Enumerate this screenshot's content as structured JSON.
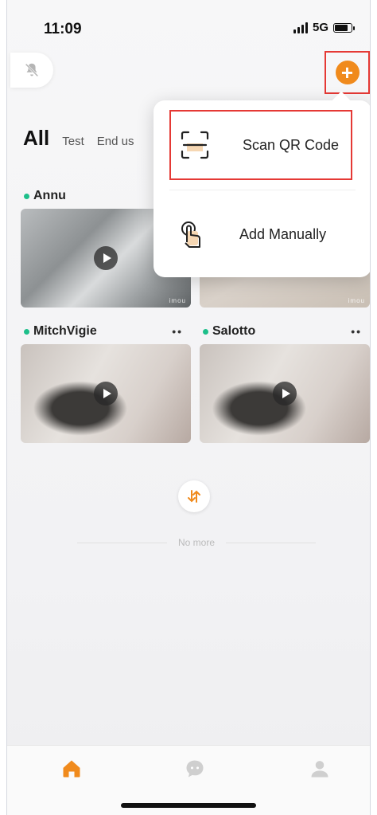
{
  "status_bar": {
    "time": "11:09",
    "network": "5G"
  },
  "tabs": [
    {
      "label": "All"
    },
    {
      "label": "Test"
    },
    {
      "label": "End us"
    }
  ],
  "devices": [
    {
      "name": "Annu",
      "online": true,
      "watermark": "imou"
    },
    {
      "name": "",
      "online": true,
      "watermark": "imou"
    },
    {
      "name": "MitchVigie",
      "online": true,
      "more_label": "••"
    },
    {
      "name": "Salotto",
      "online": true,
      "more_label": "••"
    }
  ],
  "list_footer": {
    "no_more": "No more"
  },
  "add_menu": {
    "items": [
      {
        "label": "Scan QR Code",
        "icon": "qr-scan-icon"
      },
      {
        "label": "Add Manually",
        "icon": "tap-hand-icon"
      }
    ]
  },
  "bottom_nav": [
    {
      "icon": "home-icon",
      "active": true
    },
    {
      "icon": "message-icon",
      "active": false
    },
    {
      "icon": "profile-icon",
      "active": false
    }
  ],
  "colors": {
    "accent": "#f08a1c",
    "online": "#1dbf8a",
    "highlight": "#e53935"
  }
}
